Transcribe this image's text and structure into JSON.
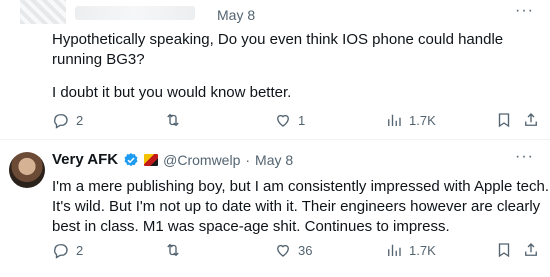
{
  "tweet1": {
    "date": "May 8",
    "more": "···",
    "lines": [
      "Hypothetically speaking, Do you even think IOS phone could handle",
      "running BG3?",
      "I doubt it but you would know better."
    ],
    "actions": {
      "replies": "2",
      "retweets": "",
      "likes": "1",
      "views": "1.7K"
    }
  },
  "tweet2": {
    "name": "Very AFK",
    "handle": "@Cromwelp",
    "dot": "·",
    "date": "May 8",
    "more": "···",
    "lines": [
      "I'm a mere publishing boy, but I am consistently impressed with Apple tech.",
      "It's wild. But I'm not up to date with it. Their engineers however are clearly",
      "best in class. M1 was space-age shit. Continues to impress."
    ],
    "actions": {
      "replies": "2",
      "retweets": "",
      "likes": "36",
      "views": "1.7K"
    }
  },
  "icons": {
    "reply": "reply-icon",
    "retweet": "retweet-icon",
    "like": "heart-icon",
    "views": "views-icon",
    "bookmark": "bookmark-icon",
    "share": "share-icon",
    "verified": "verified-badge-icon",
    "more": "more-icon"
  },
  "colors": {
    "text": "#0f1419",
    "muted": "#536471",
    "verified": "#1d9bf0",
    "divider": "#eff3f4"
  }
}
